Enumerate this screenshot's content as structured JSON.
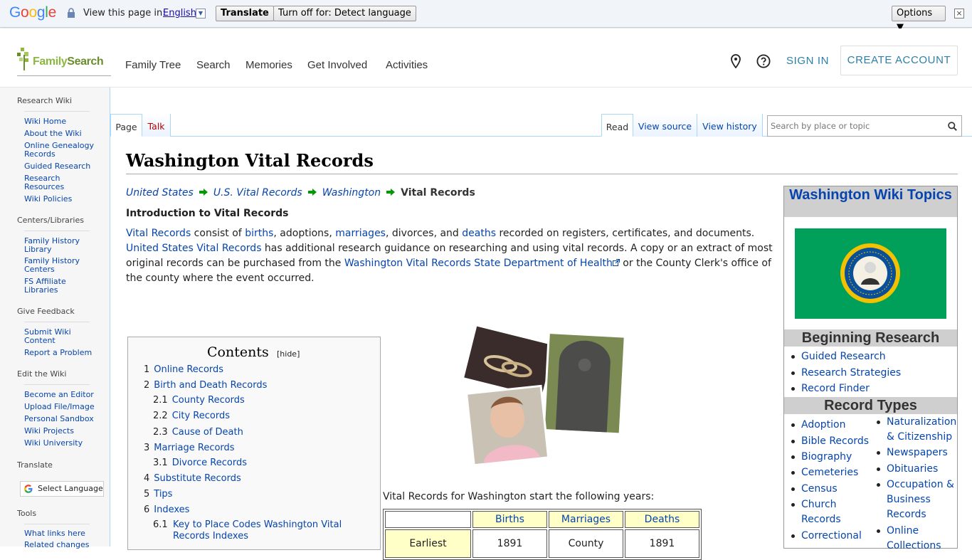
{
  "translate_bar": {
    "logo": "Google",
    "view_in": "View this page in:",
    "language": "English",
    "translate_btn": "Translate",
    "turn_off_btn": "Turn off for: Detect language",
    "options_btn": "Options ▼",
    "close": "×"
  },
  "header": {
    "logo_text_a": "Family",
    "logo_text_b": "Search",
    "nav": [
      "Family Tree",
      "Search",
      "Memories",
      "Get Involved",
      "Activities"
    ],
    "sign_in": "SIGN IN",
    "create_account": "CREATE ACCOUNT"
  },
  "sidebar": {
    "research_wiki": "Research Wiki",
    "wiki_links": [
      "Wiki Home",
      "About the Wiki",
      "Online Genealogy Records",
      "Guided Research",
      "Research Resources",
      "Wiki Policies"
    ],
    "centers": "Centers/Libraries",
    "centers_links": [
      "Family History Library",
      "Family History Centers",
      "FS Affiliate Libraries"
    ],
    "feedback": "Give Feedback",
    "feedback_links": [
      "Submit Wiki Content",
      "Report a Problem"
    ],
    "edit": "Edit the Wiki",
    "edit_links": [
      "Become an Editor",
      "Upload File/Image",
      "Personal Sandbox",
      "Wiki Projects",
      "Wiki University"
    ],
    "translate": "Translate",
    "select_language": "Select Language",
    "tools": "Tools",
    "tools_links": [
      "What links here",
      "Related changes"
    ]
  },
  "tabs": {
    "page": "Page",
    "talk": "Talk",
    "read": "Read",
    "view_source": "View source",
    "view_history": "View history",
    "search_placeholder": "Search by place or topic"
  },
  "content": {
    "title": "Washington Vital Records",
    "breadcrumb": [
      "United States",
      "U.S. Vital Records",
      "Washington"
    ],
    "breadcrumb_current": "Vital Records",
    "intro_heading": "Introduction to Vital Records",
    "intro": {
      "vital_records": "Vital Records",
      "t1": " consist of ",
      "births": "births",
      "t2": ", adoptions, ",
      "marriages": "marriages",
      "t3": ", divorces, and ",
      "deaths": "deaths",
      "t4": " recorded on registers, certificates, and documents. ",
      "us_vital": "United States Vital Records",
      "t5": " has additional research guidance on researching and using vital records. A copy or an extract of most original records can be purchased from the ",
      "wa_link": "Washington Vital Records State Department of Health",
      "t6": " or the County Clerk's office of the county where the event occurred."
    },
    "start_years_label": "Vital Records for Washington start the following years:",
    "table": {
      "headers": [
        "",
        "Births",
        "Marriages",
        "Deaths"
      ],
      "row1": [
        "Earliest",
        "1891",
        "County",
        "1891"
      ]
    }
  },
  "toc": {
    "title": "Contents",
    "hide": "[hide]",
    "items": [
      {
        "num": "1",
        "label": "Online Records"
      },
      {
        "num": "2",
        "label": "Birth and Death Records"
      },
      {
        "num": "2.1",
        "label": "County Records"
      },
      {
        "num": "2.2",
        "label": "City Records"
      },
      {
        "num": "2.3",
        "label": "Cause of Death"
      },
      {
        "num": "3",
        "label": "Marriage Records"
      },
      {
        "num": "3.1",
        "label": "Divorce Records"
      },
      {
        "num": "4",
        "label": "Substitute Records"
      },
      {
        "num": "5",
        "label": "Tips"
      },
      {
        "num": "6",
        "label": "Indexes"
      },
      {
        "num": "6.1",
        "label": "Key to Place Codes Washington Vital Records Indexes"
      }
    ]
  },
  "rightbox": {
    "title": "Washington Wiki Topics",
    "beginning": "Beginning Research",
    "beginning_links": [
      "Guided Research",
      "Research Strategies",
      "Record Finder"
    ],
    "record_types": "Record Types",
    "col1": [
      "Adoption",
      "Bible Records",
      "Biography",
      "Cemeteries",
      "Census",
      "Church Records",
      "Correctional"
    ],
    "col2": [
      "Naturalization & Citizenship",
      "Newspapers",
      "Obituaries",
      "Occupation & Business Records",
      "Online Collections"
    ]
  },
  "colors": {
    "link": "#0645ad",
    "fs_blue": "#2c7fa8",
    "fs_green": "#8cb83f",
    "flag_green": "#00a05a",
    "arrow_green": "#009900"
  }
}
